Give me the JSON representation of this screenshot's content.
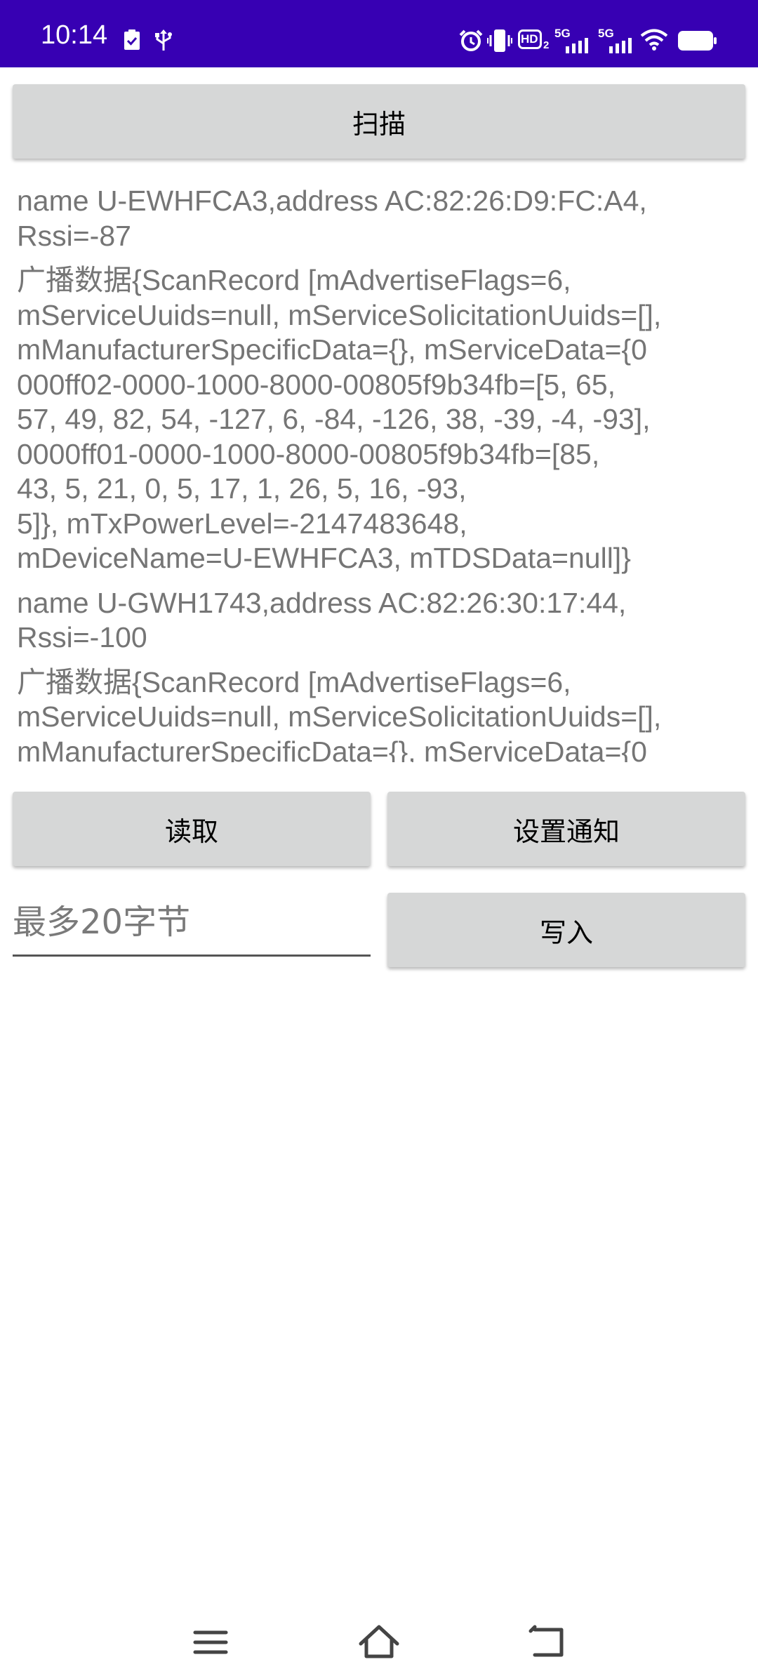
{
  "status_bar": {
    "time": "10:14",
    "hd_label": "HD",
    "hd_sub": "2",
    "net1": "5G",
    "net2": "5G",
    "icons": [
      "clipboard-check-icon",
      "usb-icon",
      "alarm-icon",
      "vibrate-icon",
      "hd-voice-icon",
      "signal-5g-icon",
      "signal-5g-icon",
      "wifi-icon",
      "battery-icon"
    ]
  },
  "scan_button": "扫描",
  "results": {
    "lines": [
      "name  U-EWHFCA3,address  AC:82:26:D9:FC:A4,",
      "Rssi=-87",
      "广播数据{ScanRecord [mAdvertiseFlags=6,",
      "mServiceUuids=null, mServiceSolicitationUuids=[],",
      "mManufacturerSpecificData={}, mServiceData={0",
      "000ff02-0000-1000-8000-00805f9b34fb=[5, 65,",
      "57, 49, 82, 54, -127, 6, -84, -126, 38, -39, -4, -93],",
      "0000ff01-0000-1000-8000-00805f9b34fb=[85,",
      "43, 5, 21, 0, 5, 17, 1, 26, 5, 16, -93,",
      "5]}, mTxPowerLevel=-2147483648,",
      "mDeviceName=U-EWHFCA3, mTDSData=null]}",
      "name  U-GWH1743,address  AC:82:26:30:17:44,",
      "Rssi=-100",
      "广播数据{ScanRecord [mAdvertiseFlags=6,",
      "mServiceUuids=null, mServiceSolicitationUuids=[],",
      "mManufacturerSpecificData={}, mServiceData={0"
    ]
  },
  "read_button": "读取",
  "notify_button": "设置通知",
  "write_input": {
    "placeholder": "最多20字节",
    "value": ""
  },
  "write_button": "写入",
  "nav_bar": {
    "icons": [
      "menu-icon",
      "home-icon",
      "back-icon"
    ]
  },
  "colors": {
    "status_bar": "#3700b3",
    "button": "#d6d7d7",
    "result_text": "#757575"
  }
}
